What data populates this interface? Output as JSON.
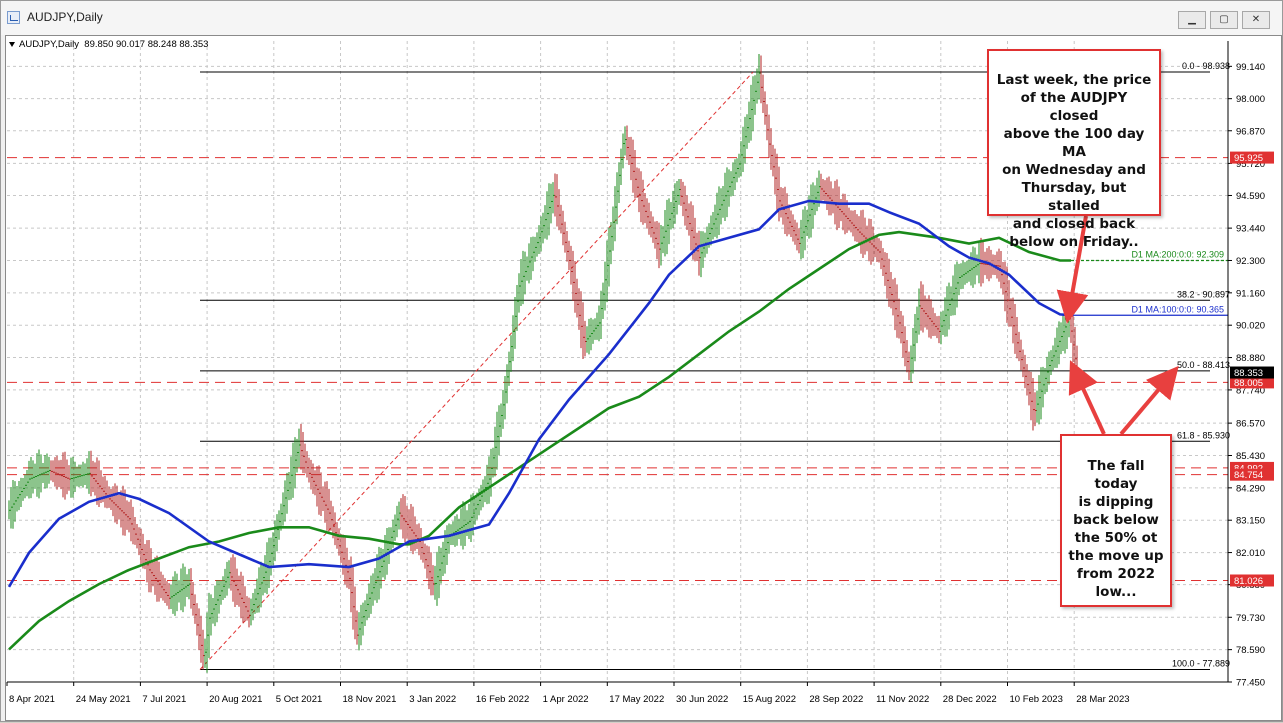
{
  "window": {
    "title": "AUDJPY,Daily",
    "controls": {
      "minimize": "▁",
      "maximize": "▢",
      "close": "✕"
    }
  },
  "symbol_info": {
    "symbol": "AUDJPY,Daily",
    "ohlc": "89.850 90.017 88.248 88.353"
  },
  "chart_data": {
    "type": "line",
    "title": "AUDJPY,Daily",
    "ylim": [
      77.45,
      99.68
    ],
    "y_ticks": [
      "99.140",
      "98.000",
      "96.870",
      "95.720",
      "94.590",
      "93.440",
      "92.300",
      "91.160",
      "90.020",
      "88.880",
      "87.740",
      "86.570",
      "85.430",
      "84.290",
      "83.150",
      "82.010",
      "80.880",
      "79.730",
      "78.590",
      "77.450"
    ],
    "x_ticks": [
      "8 Apr 2021",
      "24 May 2021",
      "7 Jul 2021",
      "20 Aug 2021",
      "5 Oct 2021",
      "18 Nov 2021",
      "3 Jan 2022",
      "16 Feb 2022",
      "1 Apr 2022",
      "17 May 2022",
      "30 Jun 2022",
      "15 Aug 2022",
      "28 Sep 2022",
      "11 Nov 2022",
      "28 Dec 2022",
      "10 Feb 2023",
      "28 Mar 2023"
    ],
    "series": [
      {
        "name": "D1 MA:200:0:0: 92.309",
        "color": "#1a8a1a",
        "points": [
          [
            0,
            78.6
          ],
          [
            30,
            79.6
          ],
          [
            60,
            80.3
          ],
          [
            90,
            80.9
          ],
          [
            120,
            81.4
          ],
          [
            150,
            81.8
          ],
          [
            180,
            82.2
          ],
          [
            210,
            82.4
          ],
          [
            240,
            82.7
          ],
          [
            270,
            82.9
          ],
          [
            300,
            82.9
          ],
          [
            330,
            82.6
          ],
          [
            360,
            82.5
          ],
          [
            390,
            82.3
          ],
          [
            400,
            82.3
          ],
          [
            420,
            82.6
          ],
          [
            450,
            83.6
          ],
          [
            480,
            84.3
          ],
          [
            510,
            85.0
          ],
          [
            540,
            85.7
          ],
          [
            570,
            86.4
          ],
          [
            600,
            87.1
          ],
          [
            630,
            87.5
          ],
          [
            660,
            88.2
          ],
          [
            690,
            89.0
          ],
          [
            720,
            89.8
          ],
          [
            750,
            90.5
          ],
          [
            780,
            91.3
          ],
          [
            810,
            92.0
          ],
          [
            840,
            92.7
          ],
          [
            870,
            93.2
          ],
          [
            890,
            93.3
          ],
          [
            930,
            93.1
          ],
          [
            960,
            92.9
          ],
          [
            990,
            93.1
          ],
          [
            1020,
            92.6
          ],
          [
            1051,
            92.3
          ],
          [
            1062,
            92.3
          ]
        ]
      },
      {
        "name": "D1 MA:100:0:0: 90.365",
        "color": "#1a2ecc",
        "points": [
          [
            0,
            80.8
          ],
          [
            20,
            82.0
          ],
          [
            50,
            83.2
          ],
          [
            80,
            83.8
          ],
          [
            110,
            84.1
          ],
          [
            130,
            83.9
          ],
          [
            160,
            83.4
          ],
          [
            200,
            82.4
          ],
          [
            240,
            81.8
          ],
          [
            260,
            81.5
          ],
          [
            300,
            81.6
          ],
          [
            340,
            81.5
          ],
          [
            370,
            81.8
          ],
          [
            400,
            82.4
          ],
          [
            440,
            82.6
          ],
          [
            460,
            82.8
          ],
          [
            480,
            83.0
          ],
          [
            500,
            84.1
          ],
          [
            530,
            86.0
          ],
          [
            560,
            87.4
          ],
          [
            600,
            89.0
          ],
          [
            640,
            90.8
          ],
          [
            660,
            91.8
          ],
          [
            690,
            92.8
          ],
          [
            720,
            93.1
          ],
          [
            750,
            93.4
          ],
          [
            770,
            94.1
          ],
          [
            800,
            94.4
          ],
          [
            830,
            94.3
          ],
          [
            860,
            94.3
          ],
          [
            880,
            94.0
          ],
          [
            910,
            93.6
          ],
          [
            940,
            92.8
          ],
          [
            960,
            92.4
          ],
          [
            980,
            92.2
          ],
          [
            1000,
            91.8
          ],
          [
            1030,
            90.8
          ],
          [
            1051,
            90.4
          ],
          [
            1062,
            90.37
          ]
        ]
      },
      {
        "name": "AUDJPY price path",
        "color": "#1a8a1a",
        "points": [
          [
            0,
            83.5
          ],
          [
            20,
            84.6
          ],
          [
            40,
            84.9
          ],
          [
            60,
            84.6
          ],
          [
            80,
            84.8
          ],
          [
            100,
            83.9
          ],
          [
            120,
            83.2
          ],
          [
            140,
            81.4
          ],
          [
            160,
            80.4
          ],
          [
            180,
            80.9
          ],
          [
            195,
            78.2
          ],
          [
            200,
            79.7
          ],
          [
            220,
            81.3
          ],
          [
            240,
            79.8
          ],
          [
            260,
            81.7
          ],
          [
            275,
            83.8
          ],
          [
            290,
            85.8
          ],
          [
            300,
            84.8
          ],
          [
            320,
            83.4
          ],
          [
            340,
            81.1
          ],
          [
            348,
            79.1
          ],
          [
            360,
            80.4
          ],
          [
            375,
            81.8
          ],
          [
            390,
            83.4
          ],
          [
            410,
            82.4
          ],
          [
            425,
            80.8
          ],
          [
            440,
            82.6
          ],
          [
            460,
            83.1
          ],
          [
            480,
            84.6
          ],
          [
            495,
            87.4
          ],
          [
            510,
            91.4
          ],
          [
            530,
            93.1
          ],
          [
            545,
            94.7
          ],
          [
            560,
            92.3
          ],
          [
            575,
            89.4
          ],
          [
            590,
            90.1
          ],
          [
            605,
            93.9
          ],
          [
            615,
            96.7
          ],
          [
            630,
            94.6
          ],
          [
            650,
            92.7
          ],
          [
            670,
            94.8
          ],
          [
            690,
            92.4
          ],
          [
            710,
            94.1
          ],
          [
            730,
            95.7
          ],
          [
            750,
            98.9
          ],
          [
            760,
            96.4
          ],
          [
            770,
            94.4
          ],
          [
            790,
            92.9
          ],
          [
            810,
            94.9
          ],
          [
            830,
            94.1
          ],
          [
            850,
            93.3
          ],
          [
            870,
            92.6
          ],
          [
            890,
            90.1
          ],
          [
            900,
            88.4
          ],
          [
            910,
            90.7
          ],
          [
            930,
            89.8
          ],
          [
            950,
            91.7
          ],
          [
            970,
            92.2
          ],
          [
            990,
            92.1
          ],
          [
            1010,
            89.1
          ],
          [
            1025,
            86.9
          ],
          [
            1040,
            88.6
          ],
          [
            1060,
            90.3
          ],
          [
            1068,
            88.35
          ]
        ]
      }
    ],
    "fib_levels": [
      {
        "label": "0.0 - 98.938",
        "value": 98.938
      },
      {
        "label": "38.2 - 90.897",
        "value": 90.897
      },
      {
        "label": "50.0 - 88.413",
        "value": 88.413
      },
      {
        "label": "61.8 - 85.930",
        "value": 85.93
      },
      {
        "label": "100.0 - 77.889",
        "value": 77.889
      }
    ],
    "horizontal_levels": [
      {
        "label": "95.925",
        "value": 95.925,
        "color": "#e03131"
      },
      {
        "label": "88.005",
        "value": 88.005,
        "color": "#e03131"
      },
      {
        "label": "84.992",
        "value": 84.992,
        "color": "#e03131"
      },
      {
        "label": "84.754",
        "value": 84.754,
        "color": "#e03131"
      },
      {
        "label": "81.026",
        "value": 81.026,
        "color": "#e03131"
      }
    ],
    "current_price": {
      "label": "88.353",
      "value": 88.353
    },
    "grid": true,
    "grid_style": "dashed"
  },
  "annotations": {
    "top_note": [
      "Last week, the price",
      "of the AUDJPY closed",
      "above the 100 day MA",
      "on Wednesday and",
      "Thursday, but stalled",
      "and closed back",
      "below on Friday.."
    ],
    "bottom_note": [
      "The fall today",
      "is dipping",
      "back below",
      "the 50% ot",
      "the move up",
      "from 2022",
      "low..."
    ],
    "arrow_color": "#e8403f"
  },
  "colors": {
    "price_up": "#1a8a1a",
    "price_down": "#b22222",
    "ma100": "#1a2ecc",
    "ma200": "#1a8a1a",
    "level_red": "#e03131",
    "grid": "#c8c8c8"
  }
}
